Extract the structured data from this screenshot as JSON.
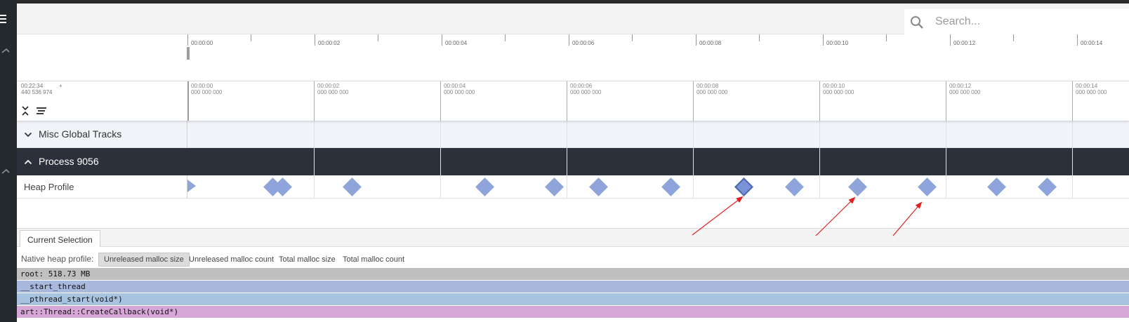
{
  "search": {
    "placeholder": "Search..."
  },
  "overview": {
    "labels": [
      "00:00:00",
      "00:00:02",
      "00:00:04",
      "00:00:06",
      "00:00:08",
      "00:00:10",
      "00:00:12",
      "00:00:14"
    ]
  },
  "timescale": {
    "offset_time": "00:22:34",
    "offset_ns": "440 536 974",
    "offset_plus": "+",
    "ticks": [
      {
        "time": "00:00:00",
        "ns": "000 000 000"
      },
      {
        "time": "00:00:02",
        "ns": "000 000 000"
      },
      {
        "time": "00:00:04",
        "ns": "000 000 000"
      },
      {
        "time": "00:00:06",
        "ns": "000 000 000"
      },
      {
        "time": "00:00:08",
        "ns": "000 000 000"
      },
      {
        "time": "00:00:10",
        "ns": "000 000 000"
      },
      {
        "time": "00:00:12",
        "ns": "000 000 000"
      },
      {
        "time": "00:00:14",
        "ns": "000 000 000"
      }
    ]
  },
  "groups": {
    "misc": {
      "title": "Misc Global Tracks",
      "expanded": false
    },
    "process": {
      "title": "Process 9056",
      "expanded": true
    }
  },
  "heap_track": {
    "name": "Heap Profile",
    "marker_times_s": [
      0.0,
      1.35,
      1.5,
      2.6,
      4.7,
      5.8,
      6.5,
      7.65,
      8.8,
      9.6,
      10.6,
      11.7,
      12.8,
      13.6
    ],
    "selected_index": 8,
    "marker_color": "#8ea4db"
  },
  "bottom": {
    "tab_label": "Current Selection",
    "profile_label": "Native heap profile:",
    "modes": [
      "Unreleased malloc size",
      "Unreleased malloc count",
      "Total malloc size",
      "Total malloc count"
    ],
    "active_mode": 0
  },
  "flamegraph": [
    {
      "label": "root: 518.73 MB",
      "color": "#c0c0c0"
    },
    {
      "label": "__start_thread",
      "color": "#a9b8dd"
    },
    {
      "label": "__pthread_start(void*)",
      "color": "#a8c3e0"
    },
    {
      "label": "art::Thread::CreateCallback(void*)",
      "color": "#d7a7d8"
    }
  ],
  "colors": {
    "process_header": "#2b303a",
    "misc_header": "#f1f4f8",
    "annotation_arrow": "#e02020"
  }
}
